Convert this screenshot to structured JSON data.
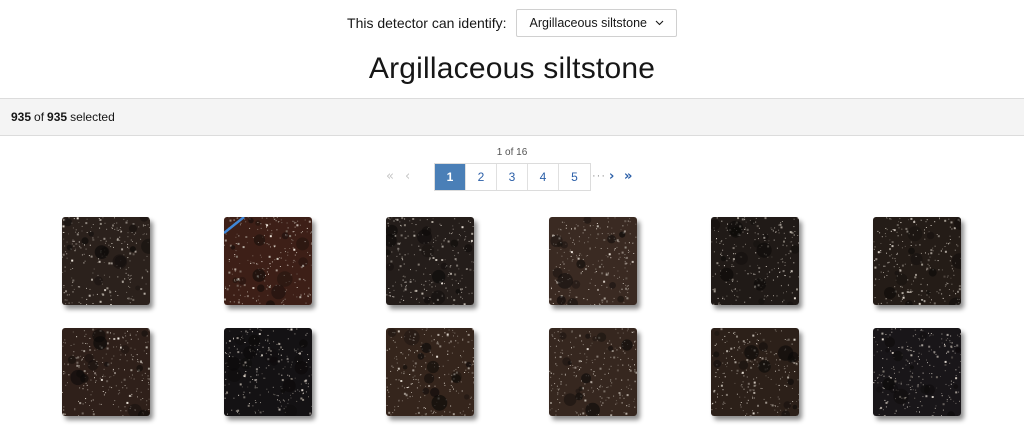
{
  "detector": {
    "label": "This detector can identify:",
    "selected": "Argillaceous siltstone"
  },
  "title": "Argillaceous siltstone",
  "selection": {
    "count": "935",
    "of": "of",
    "total": "935",
    "suffix": "selected"
  },
  "pagination": {
    "indicator": "1 of 16",
    "current": 1,
    "pages": [
      "1",
      "2",
      "3",
      "4",
      "5"
    ],
    "ellipsis": "···"
  },
  "thumbnails": [
    {
      "alt": "thin section 1",
      "tone": "#2b211c"
    },
    {
      "alt": "thin section 2",
      "tone": "#3d1f17",
      "vein": "#3f86d6"
    },
    {
      "alt": "thin section 3",
      "tone": "#241d1a"
    },
    {
      "alt": "thin section 4",
      "tone": "#3a2a22"
    },
    {
      "alt": "thin section 5",
      "tone": "#201a17"
    },
    {
      "alt": "thin section 6",
      "tone": "#241c17"
    },
    {
      "alt": "thin section 7",
      "tone": "#2f201a"
    },
    {
      "alt": "thin section 8",
      "tone": "#141214"
    },
    {
      "alt": "thin section 9",
      "tone": "#35251c"
    },
    {
      "alt": "thin section 10",
      "tone": "#36271f"
    },
    {
      "alt": "thin section 11",
      "tone": "#2c2019"
    },
    {
      "alt": "thin section 12",
      "tone": "#191619"
    }
  ],
  "colors": {
    "accent": "#4a7fb7",
    "link": "#2b5fa8"
  }
}
